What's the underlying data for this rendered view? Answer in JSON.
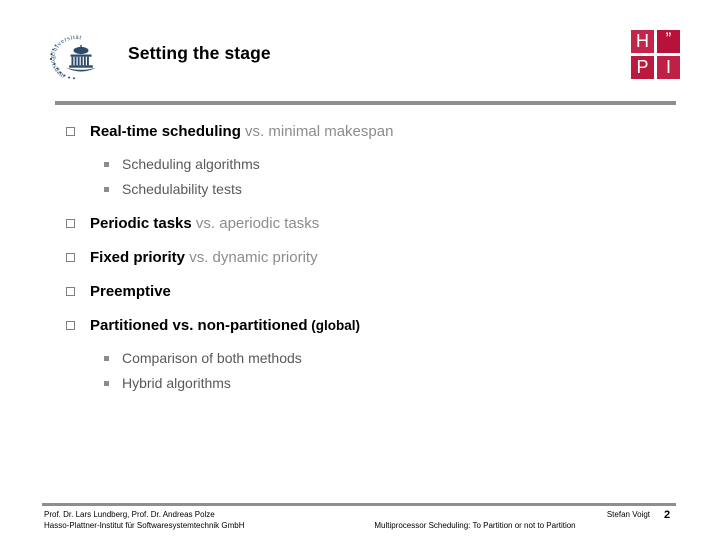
{
  "slide": {
    "title": "Setting the stage",
    "page_number": "2",
    "accent_color": "#8e8e8e",
    "hpi_red": "#bb1133",
    "muted_text_color": "#8c8c8c"
  },
  "logos": {
    "university": {
      "name": "university-of-potsdam-seal",
      "ring_text_top": "Universität",
      "ring_text_bottom": "Potsdam"
    },
    "hpi": {
      "name": "hpi-logo",
      "cells": [
        "H",
        "”",
        "P",
        "I"
      ]
    }
  },
  "bullets": [
    {
      "level": 1,
      "strong": "Real-time scheduling",
      "muted": " vs. minimal makespan"
    },
    {
      "level": 2,
      "text": "Scheduling algorithms"
    },
    {
      "level": 2,
      "text": "Schedulability tests"
    },
    {
      "level": 1,
      "strong": "Periodic tasks",
      "muted": " vs. aperiodic tasks"
    },
    {
      "level": 1,
      "strong": "Fixed priority",
      "muted": " vs. dynamic priority"
    },
    {
      "level": 1,
      "strong": "Preemptive",
      "muted": ""
    },
    {
      "level": 1,
      "strong": "Partitioned vs. non-partitioned",
      "small": " (global)"
    },
    {
      "level": 2,
      "text": "Comparison of both methods"
    },
    {
      "level": 2,
      "text": "Hybrid algorithms"
    }
  ],
  "footer": {
    "left_line1": "Prof. Dr. Lars Lundberg,  Prof. Dr. Andreas Polze",
    "left_line2": "Hasso-Plattner-Institut für Softwaresystemtechnik GmbH",
    "right_line1": "Stefan Voigt",
    "right_line2": "Multiprocessor Scheduling: To Partition or not to Partition"
  }
}
